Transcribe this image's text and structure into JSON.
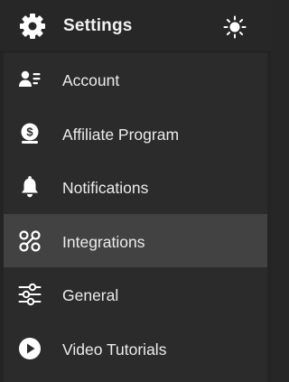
{
  "header": {
    "title": "Settings",
    "icons": {
      "left": "gear-icon",
      "right": "sun-icon"
    }
  },
  "menu": {
    "items": [
      {
        "label": "Account",
        "icon": "account-card-icon",
        "active": false
      },
      {
        "label": "Affiliate Program",
        "icon": "dollar-badge-icon",
        "active": false
      },
      {
        "label": "Notifications",
        "icon": "bell-icon",
        "active": false
      },
      {
        "label": "Integrations",
        "icon": "integrations-icon",
        "active": true
      },
      {
        "label": "General",
        "icon": "sliders-icon",
        "active": false
      },
      {
        "label": "Video Tutorials",
        "icon": "play-circle-icon",
        "active": false
      }
    ]
  },
  "colors": {
    "background": "#2b2b2c",
    "header_background": "#272727",
    "active_item_background": "#424243",
    "text": "#ececec",
    "icon": "#ffffff"
  }
}
